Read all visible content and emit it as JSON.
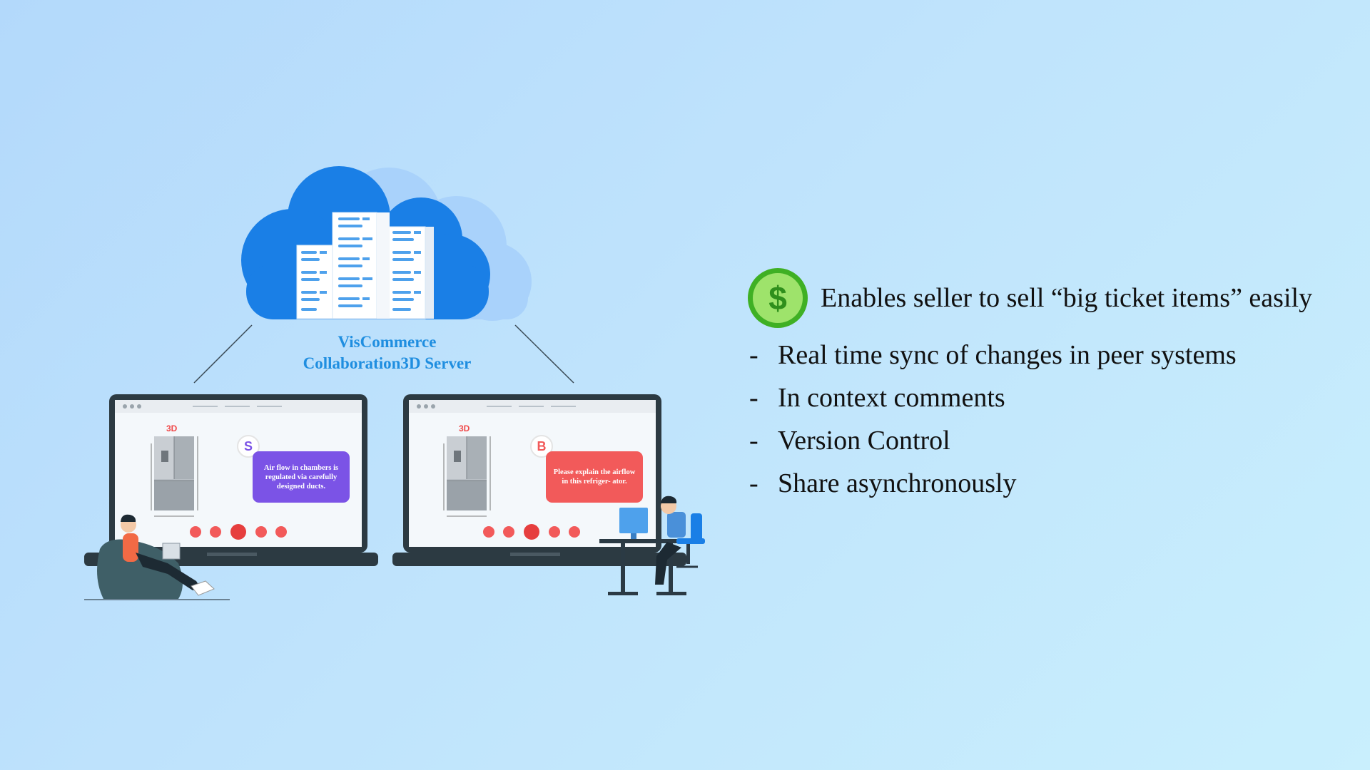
{
  "cloud": {
    "label_line1": "VisCommerce",
    "label_line2": "Collaboration3D Server"
  },
  "left_screen": {
    "badge": "3D",
    "avatar_letter": "S",
    "message": "Air flow in chambers is regulated via carefully designed ducts."
  },
  "right_screen": {
    "badge": "3D",
    "avatar_letter": "B",
    "message": "Please explain the airflow in this refriger- ator."
  },
  "features": {
    "headline": "Enables seller to sell “big ticket items” easily",
    "icon": "dollar-coin-icon",
    "bullet_symbol": "-",
    "items": [
      "Real time sync of changes in peer systems",
      "In context comments",
      "Version Control",
      "Share asynchronously"
    ]
  },
  "colors": {
    "cloud_blue": "#1a7fe6",
    "label_blue": "#1f8ee0",
    "purple_bubble": "#7b53e6",
    "red_bubble": "#f25a5a",
    "coin_green": "#3fb024"
  }
}
